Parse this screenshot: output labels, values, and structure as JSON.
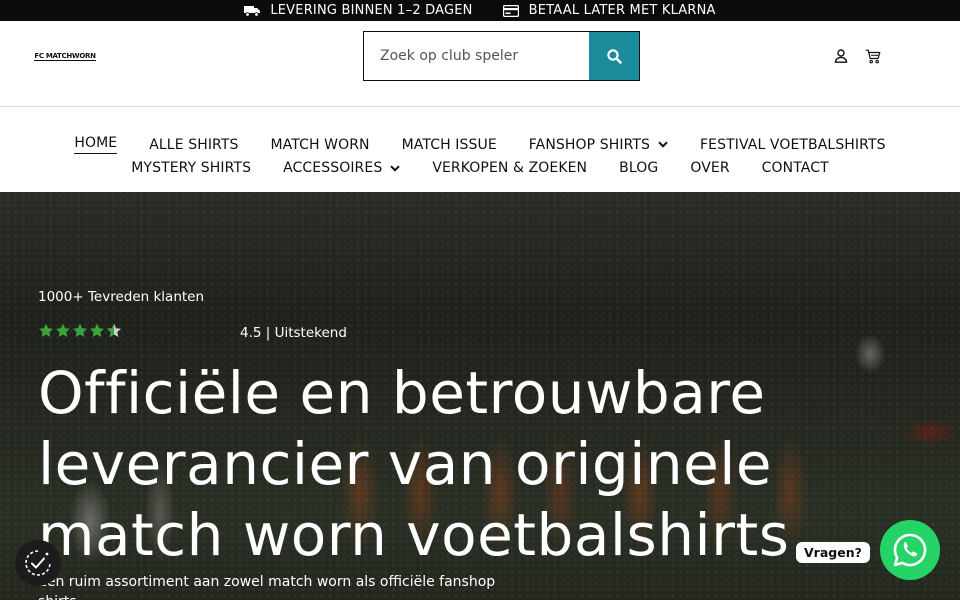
{
  "topbar": {
    "delivery_icon": "truck-icon",
    "delivery_text": "LEVERING BINNEN 1–2 DAGEN",
    "payment_icon": "credit-card-icon",
    "payment_text": "BETAAL LATER MET KLARNA"
  },
  "header": {
    "logo_text": "FC MATCHWORN",
    "search": {
      "placeholder": "Zoek op club speler",
      "value": "",
      "button_icon": "search-icon"
    },
    "icons": [
      "user-icon",
      "cart-icon"
    ],
    "accent_color": "#1b8a9a"
  },
  "nav": {
    "row1": [
      {
        "label": "HOME",
        "active": true
      },
      {
        "label": "ALLE SHIRTS"
      },
      {
        "label": "MATCH WORN"
      },
      {
        "label": "MATCH ISSUE"
      },
      {
        "label": "FANSHOP SHIRTS",
        "dropdown": true
      },
      {
        "label": "FESTIVAL VOETBALSHIRTS"
      }
    ],
    "row2": [
      {
        "label": "MYSTERY SHIRTS"
      },
      {
        "label": "ACCESSOIRES",
        "dropdown": true
      },
      {
        "label": "VERKOPEN & ZOEKEN"
      },
      {
        "label": "BLOG"
      },
      {
        "label": "OVER"
      },
      {
        "label": "CONTACT"
      }
    ]
  },
  "hero": {
    "kicker": "1000+ Tevreden klanten",
    "rating_stars": 4.5,
    "rating_text": "4.5 | Uitstekend",
    "star_color": "#3aa63a",
    "title": "Officiële en betrouwbare leverancier van originele match worn voetbalshirts",
    "subtitle": "Een ruim assortiment aan zowel match worn als officiële fanshop",
    "subtitle_cont": "shirts"
  },
  "widgets": {
    "cookie_icon": "cookie-consent-icon",
    "chat_label": "Vragen?",
    "whatsapp_icon": "whatsapp-icon",
    "whatsapp_color": "#25d366"
  }
}
